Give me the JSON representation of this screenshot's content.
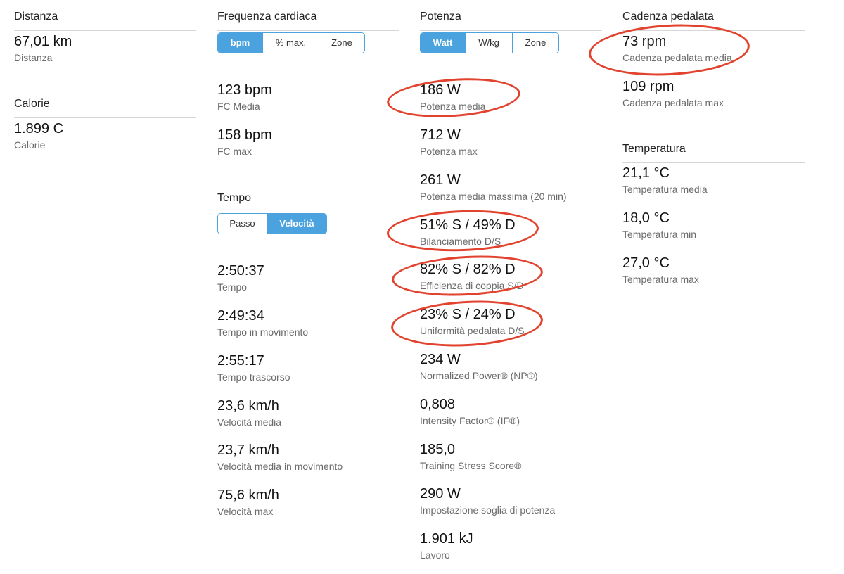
{
  "distanza": {
    "title": "Distanza",
    "stats": [
      {
        "value": "67,01 km",
        "label": "Distanza"
      }
    ]
  },
  "calorie": {
    "title": "Calorie",
    "stats": [
      {
        "value": "1.899 C",
        "label": "Calorie"
      }
    ]
  },
  "frequenza": {
    "title": "Frequenza cardiaca",
    "segments": [
      {
        "label": "bpm",
        "active": true
      },
      {
        "label": "% max.",
        "active": false
      },
      {
        "label": "Zone",
        "active": false
      }
    ],
    "stats": [
      {
        "value": "123 bpm",
        "label": "FC Media"
      },
      {
        "value": "158 bpm",
        "label": "FC max"
      }
    ]
  },
  "tempo": {
    "title": "Tempo",
    "segments": [
      {
        "label": "Passo",
        "active": false
      },
      {
        "label": "Velocità",
        "active": true
      }
    ],
    "stats": [
      {
        "value": "2:50:37",
        "label": "Tempo"
      },
      {
        "value": "2:49:34",
        "label": "Tempo in movimento"
      },
      {
        "value": "2:55:17",
        "label": "Tempo trascorso"
      },
      {
        "value": "23,6 km/h",
        "label": "Velocità media"
      },
      {
        "value": "23,7 km/h",
        "label": "Velocità media in movimento"
      },
      {
        "value": "75,6 km/h",
        "label": "Velocità max"
      }
    ]
  },
  "potenza": {
    "title": "Potenza",
    "segments": [
      {
        "label": "Watt",
        "active": true
      },
      {
        "label": "W/kg",
        "active": false
      },
      {
        "label": "Zone",
        "active": false
      }
    ],
    "stats": [
      {
        "value": "186 W",
        "label": "Potenza media"
      },
      {
        "value": "712 W",
        "label": "Potenza max"
      },
      {
        "value": "261 W",
        "label": "Potenza media massima (20 min)"
      },
      {
        "value": "51% S / 49% D",
        "label": "Bilanciamento D/S"
      },
      {
        "value": "82% S / 82% D",
        "label": "Efficienza di coppia S/D"
      },
      {
        "value": "23% S / 24% D",
        "label": "Uniformità pedalata D/S"
      },
      {
        "value": "234 W",
        "label": "Normalized Power® (NP®)"
      },
      {
        "value": "0,808",
        "label": "Intensity Factor® (IF®)"
      },
      {
        "value": "185,0",
        "label": "Training Stress Score®"
      },
      {
        "value": "290 W",
        "label": "Impostazione soglia di potenza"
      },
      {
        "value": "1.901 kJ",
        "label": "Lavoro"
      }
    ]
  },
  "cadenza": {
    "title": "Cadenza pedalata",
    "stats": [
      {
        "value": "73 rpm",
        "label": "Cadenza pedalata media"
      },
      {
        "value": "109 rpm",
        "label": "Cadenza pedalata max"
      }
    ]
  },
  "temperatura": {
    "title": "Temperatura",
    "stats": [
      {
        "value": "21,1 °C",
        "label": "Temperatura media"
      },
      {
        "value": "18,0 °C",
        "label": "Temperatura min"
      },
      {
        "value": "27,0 °C",
        "label": "Temperatura max"
      }
    ]
  },
  "theme": {
    "accent": "#4aa3df",
    "annotation": "#e2432e"
  }
}
